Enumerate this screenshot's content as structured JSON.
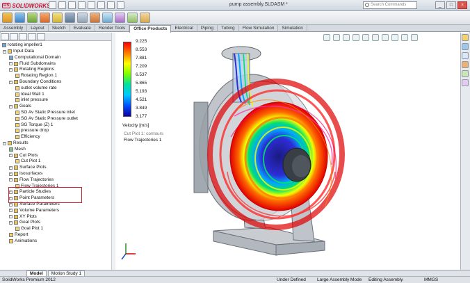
{
  "app": {
    "logo": "SOLIDWORKS",
    "logo_mark": "DS",
    "document_title": "pump assembly.SLDASM *",
    "search_placeholder": "Search Commands",
    "window_buttons": {
      "minimize": "_",
      "restore": "□",
      "close": "×"
    }
  },
  "tabs": [
    "Assembly",
    "Layout",
    "Sketch",
    "Evaluate",
    "Render Tools",
    "Office Products",
    "Electrical",
    "Piping",
    "Tubing",
    "Flow Simulation",
    "Simulation"
  ],
  "active_tab": "Office Products",
  "tree": {
    "root": "rotating impeller1",
    "items": [
      {
        "label": "Input Data",
        "level": 1,
        "icon": "folder"
      },
      {
        "label": "Computational Domain",
        "level": 2,
        "icon": "domain"
      },
      {
        "label": "Fluid Subdomains",
        "level": 2,
        "icon": "folder"
      },
      {
        "label": "Rotating Regions",
        "level": 2,
        "icon": "folder"
      },
      {
        "label": "Rotating Region 1",
        "level": 3,
        "icon": "item"
      },
      {
        "label": "Boundary Conditions",
        "level": 2,
        "icon": "folder"
      },
      {
        "label": "outlet volume rate",
        "level": 3,
        "icon": "item"
      },
      {
        "label": "Ideal Wall 1",
        "level": 3,
        "icon": "item"
      },
      {
        "label": "inlet pressure",
        "level": 3,
        "icon": "item"
      },
      {
        "label": "Goals",
        "level": 2,
        "icon": "folder"
      },
      {
        "label": "SG Av Static Pressure inlet",
        "level": 3,
        "icon": "item"
      },
      {
        "label": "SG Av Static Pressure outlet",
        "level": 3,
        "icon": "item"
      },
      {
        "label": "SG Torque (Z) 1",
        "level": 3,
        "icon": "item"
      },
      {
        "label": "pressure drop",
        "level": 3,
        "icon": "item"
      },
      {
        "label": "Efficiency",
        "level": 3,
        "icon": "item"
      },
      {
        "label": "Results",
        "level": 1,
        "icon": "folder"
      },
      {
        "label": "Mesh",
        "level": 2,
        "icon": "mesh"
      },
      {
        "label": "Cut Plots",
        "level": 2,
        "icon": "folder"
      },
      {
        "label": "Cut Plot 1",
        "level": 3,
        "icon": "item"
      },
      {
        "label": "Surface Plots",
        "level": 2,
        "icon": "folder"
      },
      {
        "label": "Isosurfaces",
        "level": 2,
        "icon": "folder"
      },
      {
        "label": "Flow Trajectories",
        "level": 2,
        "icon": "folder"
      },
      {
        "label": "Flow Trajectories 1",
        "level": 3,
        "icon": "item"
      },
      {
        "label": "Particle Studies",
        "level": 2,
        "icon": "folder"
      },
      {
        "label": "Point Parameters",
        "level": 2,
        "icon": "folder"
      },
      {
        "label": "Surface Parameters",
        "level": 2,
        "icon": "folder"
      },
      {
        "label": "Volume Parameters",
        "level": 2,
        "icon": "folder"
      },
      {
        "label": "XY Plots",
        "level": 2,
        "icon": "folder"
      },
      {
        "label": "Goal Plots",
        "level": 2,
        "icon": "folder"
      },
      {
        "label": "Goal Plot 1",
        "level": 3,
        "icon": "item"
      },
      {
        "label": "Report",
        "level": 2,
        "icon": "item"
      },
      {
        "label": "Animations",
        "level": 2,
        "icon": "item"
      }
    ]
  },
  "legend": {
    "values": [
      "9.225",
      "8.553",
      "7.881",
      "7.209",
      "6.537",
      "5.865",
      "5.193",
      "4.521",
      "3.849",
      "3.177"
    ],
    "title": "Velocity [m/s]",
    "colors": [
      "#ff0000",
      "#ff7a00",
      "#ffff00",
      "#7cff00",
      "#00e0a0",
      "#00c8ff",
      "#0050ff",
      "#1000a0"
    ]
  },
  "viewport_labels": {
    "cut_plot": "Cut Plot 1: contours",
    "flow_traj": "Flow Trajectories 1"
  },
  "bottom_tabs": [
    "Model",
    "Motion Study 1"
  ],
  "active_bottom_tab": "Model",
  "status": {
    "product": "SolidWorks Premium 2012",
    "definition": "Under Defined",
    "mode": "Large Assembly Mode",
    "editing": "Editing Assembly",
    "units": "MMGS"
  },
  "colors": {
    "brand": "#c8102e",
    "highlight_box": "#d0232a",
    "pump_body": "#9aa0a8"
  }
}
